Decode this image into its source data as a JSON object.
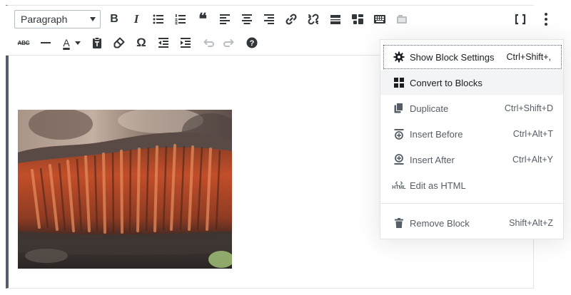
{
  "toolbar": {
    "format_select": {
      "value": "Paragraph"
    },
    "row1": [
      "bold",
      "italic",
      "bulleted-list",
      "numbered-list",
      "blockquote",
      "align-left",
      "align-center",
      "align-right",
      "insert-link",
      "remove-link",
      "read-more",
      "toolbar-toggle",
      "keyboard-shortcuts",
      "insert-image"
    ],
    "row2": [
      "strikethrough",
      "horizontal-line",
      "text-color",
      "paste-as-text",
      "clear-formatting",
      "special-character",
      "decrease-indent",
      "increase-indent",
      "undo",
      "redo",
      "help"
    ],
    "bold_glyph": "B",
    "italic_glyph": "I",
    "quote_glyph": "❝",
    "strike_glyph": "ABC",
    "textcolor_glyph": "A",
    "omega_glyph": "Ω",
    "help_glyph": "?"
  },
  "block_menu": {
    "items": [
      {
        "icon": "gear-icon",
        "label": "Show Block Settings",
        "shortcut": "Ctrl+Shift+,"
      },
      {
        "icon": "blocks-icon",
        "label": "Convert to Blocks",
        "shortcut": ""
      },
      {
        "icon": "duplicate-icon",
        "label": "Duplicate",
        "shortcut": "Ctrl+Shift+D"
      },
      {
        "icon": "insert-before-icon",
        "label": "Insert Before",
        "shortcut": "Ctrl+Alt+T"
      },
      {
        "icon": "insert-after-icon",
        "label": "Insert After",
        "shortcut": "Ctrl+Alt+Y"
      },
      {
        "icon": "html-icon",
        "label": "Edit as HTML",
        "shortcut": ""
      },
      {
        "icon": "trash-icon",
        "label": "Remove Block",
        "shortcut": "Shift+Alt+Z"
      }
    ],
    "html_icon_text": "HTML"
  },
  "colors": {
    "toolbar_icon": "#32373c",
    "disabled_icon": "#b9bec3",
    "menu_text": "#555d66",
    "menu_hover_bg": "#f3f4f5",
    "block_border": "#555d66",
    "text_color_underline": "#32373c"
  }
}
